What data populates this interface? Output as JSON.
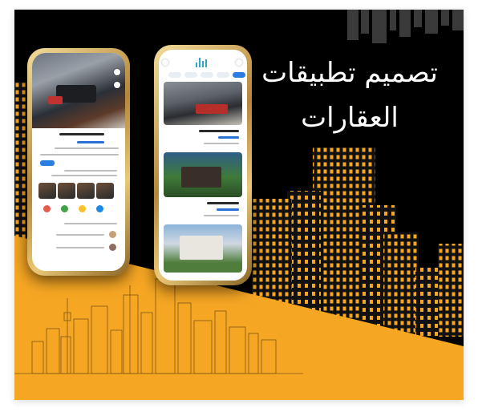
{
  "headline": {
    "line1": "تصميم تطبيقات",
    "line2": "العقارات"
  },
  "colors": {
    "background": "#000000",
    "accent": "#F5A623",
    "window_light": "#F5A623",
    "phone_frame": "#C9A052",
    "headline": "#FFFFFF"
  }
}
